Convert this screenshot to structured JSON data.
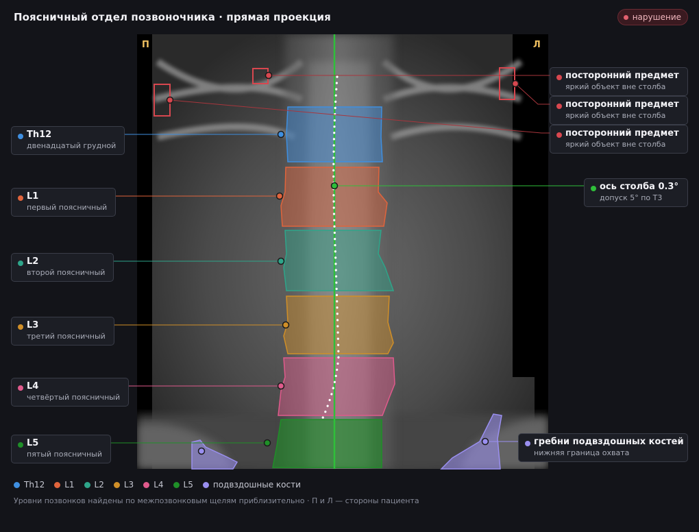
{
  "header": {
    "title": "Поясничный отдел позвоночника · прямая проекция",
    "badge": "нарушение"
  },
  "image": {
    "side_right": "П",
    "side_left": "Л"
  },
  "colors": {
    "Th12": "#3f8fe0",
    "L1": "#e0643c",
    "L2": "#2ea58a",
    "L3": "#d08f28",
    "L4": "#e05a8c",
    "L5": "#1f8f28",
    "ilium": "#9a8ff0",
    "foreign": "#d8474f",
    "axis": "#2fbf3a"
  },
  "vertebrae": [
    {
      "key": "Th12",
      "name": "Th12",
      "desc": "двенадцатый грудной"
    },
    {
      "key": "L1",
      "name": "L1",
      "desc": "первый поясничный"
    },
    {
      "key": "L2",
      "name": "L2",
      "desc": "второй поясничный"
    },
    {
      "key": "L3",
      "name": "L3",
      "desc": "третий поясничный"
    },
    {
      "key": "L4",
      "name": "L4",
      "desc": "четвёртый поясничный"
    },
    {
      "key": "L5",
      "name": "L5",
      "desc": "пятый поясничный"
    }
  ],
  "foreign_objects": [
    {
      "title": "посторонний предмет",
      "desc": "яркий объект вне столба"
    },
    {
      "title": "посторонний предмет",
      "desc": "яркий объект вне столба"
    },
    {
      "title": "посторонний предмет",
      "desc": "яркий объект вне столба"
    }
  ],
  "axis": {
    "title": "ось столба 0.3°",
    "desc": "допуск 5° по Т3"
  },
  "ilium": {
    "title": "гребни подвздошных костей",
    "desc": "нижняя граница охвата"
  },
  "legend": [
    "Th12",
    "L1",
    "L2",
    "L3",
    "L4",
    "L5",
    "подвздошные кости"
  ],
  "footnote": "Уровни позвонков найдены по межпозвонковым щелям приблизительно · П и Л — стороны пациента"
}
